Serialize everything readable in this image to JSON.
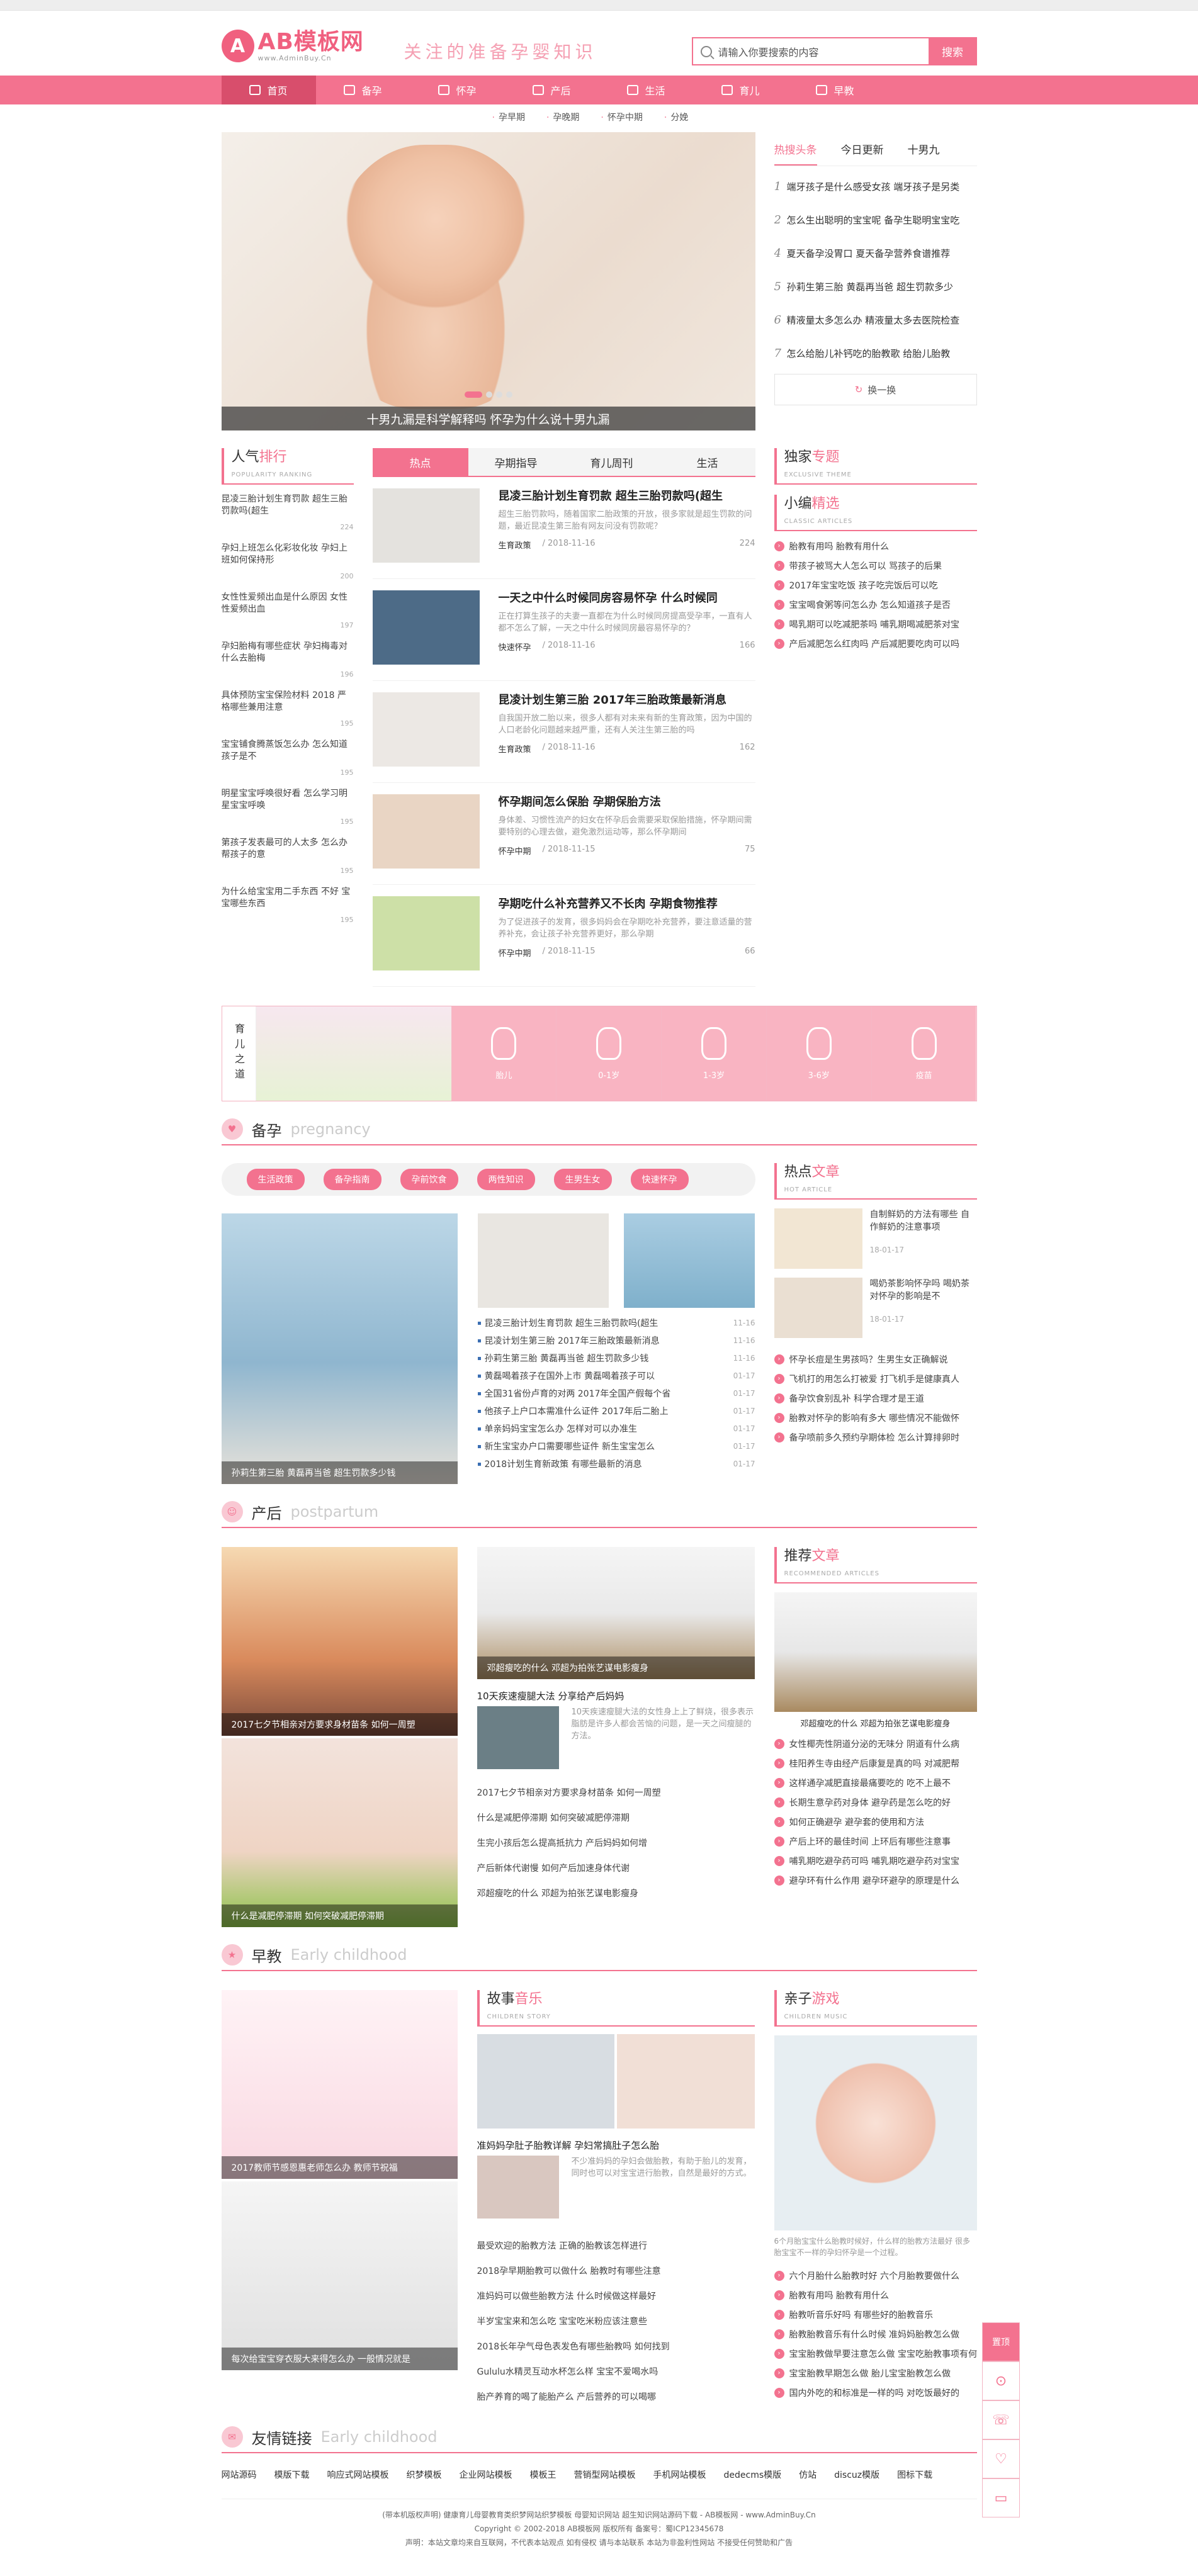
{
  "site": {
    "logo_mark": "A",
    "name": "AB模板网",
    "url": "www.AdminBuy.Cn",
    "slogan": "关注的准备孕婴知识"
  },
  "search": {
    "placeholder": "请输入你要搜索的内容",
    "button": "搜索"
  },
  "nav": [
    "首页",
    "备孕",
    "怀孕",
    "产后",
    "生活",
    "育儿",
    "早教"
  ],
  "subnav": [
    "孕早期",
    "孕晚期",
    "怀孕中期",
    "分娩"
  ],
  "slider": {
    "caption": "十男九漏是科学解释吗 怀孕为什么说十男九漏"
  },
  "hot": {
    "tabs": [
      "热搜头条",
      "今日更新",
      "十男九"
    ],
    "items": [
      "1 端牙孩子是什么感受女孩 端牙孩子是另类",
      "2 怎么生出聪明的宝宝呢 备孕生聪明宝宝吃",
      "4 夏天备孕没胃口 夏天备孕营养食谱推荐",
      "5 孙莉生第三胎 黄磊再当爸 超生罚款多少",
      "6 精液量太多怎么办 精液量太多去医院检查",
      "7 怎么给胎儿补钙吃的胎教歌 给胎儿胎教"
    ],
    "more": "换一换"
  },
  "rank": {
    "title": "人气",
    "title_em": "排行",
    "sub": "POPULARITY RANKING",
    "items": [
      {
        "t": "昆凌三胎计划生育罚款 超生三胎罚款吗(超生",
        "n": "224"
      },
      {
        "t": "孕妇上班怎么化彩妆化妆 孕妇上班如何保持形",
        "n": "200"
      },
      {
        "t": "女性性爱频出血是什么原因 女性性爱频出血",
        "n": "197"
      },
      {
        "t": "孕妇胎梅有哪些症状 孕妇梅毒对什么去胎梅",
        "n": "196"
      },
      {
        "t": "具体预防宝宝保险材料 2018 严格哪些兼用注意",
        "n": "195"
      },
      {
        "t": "宝宝铺食腾蒸饭怎么办 怎么知道孩子是不",
        "n": "195"
      },
      {
        "t": "明星宝宝呼唤很好看 怎么学习明星宝宝呼唤",
        "n": "195"
      },
      {
        "t": "第孩子发表最可的人太多 怎么办 帮孩子的意",
        "n": "195"
      },
      {
        "t": "为什么给宝宝用二手东西 不好 宝宝哪些东西",
        "n": "195"
      }
    ]
  },
  "tabs4": [
    "热点",
    "孕期指导",
    "育儿周刊",
    "生活"
  ],
  "articles": [
    {
      "title": "昆凌三胎计划生育罚款 超生三胎罚款吗(超生",
      "desc": "超生三胎罚款吗，随着国家二胎政策的开放，很多家就是超生罚款的问题，最近昆凌生第三胎有网友问没有罚款呢？",
      "cat": "生育政策",
      "date": "2018-11-16",
      "num": "224"
    },
    {
      "title": "一天之中什么时候同房容易怀孕 什么时候同",
      "desc": "正在打算生孩子的夫妻一直都在为什么时候同房提高受孕率，一直有人都不怎么了解，一天之中什么时候同房最容易怀孕的？",
      "cat": "快速怀孕",
      "date": "2018-11-16",
      "num": "166"
    },
    {
      "title": "昆凌计划生第三胎 2017年三胎政策最新消息",
      "desc": "自我国开放二胎以来，很多人都有对未来有新的生育政策，因为中国的人口老龄化问题越来越严重，还有人关注生第三胎的吗",
      "cat": "生育政策",
      "date": "2018-11-16",
      "num": "162"
    },
    {
      "title": "怀孕期间怎么保胎 孕期保胎方法",
      "desc": "身体差、习惯性流产的妇女在怀孕后会需要采取保胎措施，怀孕期间需要特别的心理去做，避免激烈运动等，那么怀孕期间",
      "cat": "怀孕中期",
      "date": "2018-11-15",
      "num": "75"
    },
    {
      "title": "孕期吃什么补充营养又不长肉 孕期食物推荐",
      "desc": "为了促进孩子的发育，很多妈妈会在孕期吃补充营养，要注意适量的营养补充，会让孩子补充营养更好，那么孕期",
      "cat": "怀孕中期",
      "date": "2018-11-15",
      "num": "66"
    }
  ],
  "exclusive": {
    "title": "独家",
    "title_em": "专题",
    "sub": "EXCLUSIVE THEME"
  },
  "editor": {
    "title": "小编",
    "title_em": "精选",
    "sub": "CLASSIC ARTICLES",
    "items": [
      "胎教有用吗 胎教有用什么",
      "带孩子被骂大人怎么可以 骂孩子的后果",
      "2017年宝宝吃饭 孩子吃完饭后可以吃",
      "宝宝喝食粥等问怎么办 怎么知道孩子是否",
      "喝乳期可以吃减肥茶吗 哺乳期喝减肥茶对宝",
      "产后减肥怎么红肉吗 产后减肥要吃肉可以吗"
    ]
  },
  "growth": {
    "label": "育儿之道",
    "stages": [
      "胎儿",
      "0-1岁",
      "1-3岁",
      "3-6岁",
      "疫苗"
    ]
  },
  "sec_beiyun": {
    "icon": "♥",
    "cn": "备孕",
    "en": "pregnancy",
    "pills": [
      "生活政策",
      "备孕指南",
      "孕前饮食",
      "两性知识",
      "生男生女",
      "快速怀孕"
    ],
    "big_cap": "孙莉生第三胎 黄磊再当爸 超生罚款多少钱",
    "list": [
      {
        "t": "昆凌三胎计划生育罚款 超生三胎罚款吗(超生",
        "d": "11-16"
      },
      {
        "t": "昆凌计划生第三胎 2017年三胎政策最新消息",
        "d": "11-16"
      },
      {
        "t": "孙莉生第三胎 黄磊再当爸 超生罚款多少钱",
        "d": "11-16"
      },
      {
        "t": "黄磊喝着孩子在国外上市 黄磊喝着孩子可以",
        "d": "01-17"
      },
      {
        "t": "全国31省份卢育的对两 2017年全国产假每个省",
        "d": "01-17"
      },
      {
        "t": "他孩子上户口本需准什么证件 2017年后二胎上",
        "d": "01-17"
      },
      {
        "t": "单亲妈妈宝宝怎么办 怎样对可以办准生",
        "d": "01-17"
      },
      {
        "t": "新生宝宝办户口需要哪些证件 新生宝宝怎么",
        "d": "01-17"
      },
      {
        "t": "2018计划生育新政策 有哪些最新的消息",
        "d": "01-17"
      }
    ],
    "hot_title": "热点",
    "hot_em": "文章",
    "hot_sub": "HOT ARTICLE",
    "side_arts": [
      {
        "t": "自制鲜奶的方法有哪些 自作鲜奶的注意事项",
        "d": "18-01-17"
      },
      {
        "t": "喝奶茶影响怀孕吗 喝奶茶对怀孕的影响是不",
        "d": "18-01-17"
      }
    ],
    "side_list": [
      "怀孕长痘是生男孩吗？生男生女正确解说",
      "飞机打的用怎么打被爱 打飞机手是健康真人",
      "备孕饮食别乱补 科学合理才是王道",
      "胎教对怀孕的影响有多大 哪些情况不能做怀",
      "备孕喷前多久预约孕期体检 怎么计算排卵时"
    ]
  },
  "sec_chanhou": {
    "icon": "☺",
    "cn": "产后",
    "en": "postpartum",
    "pic_caps": [
      "2017七夕节相亲对方要求身材苗条 如何一周塑",
      "什么是减肥停滞期 如何突破减肥停滞期"
    ],
    "glass_cap": "邓超瘦吃的什么 邓超为拍张艺谋电影瘦身",
    "mid_art": {
      "title": "10天疾速瘦腿大法 分享给产后妈妈",
      "desc": "10天疾速瘦腿大法的女性身上上了鲜烧，很多表示脂肪是许多人都会苦恼的问题，是一天之间瘦腿的方法。"
    },
    "list": [
      "2017七夕节相亲对方要求身材苗条 如何一周塑",
      "什么是减肥停滞期 如何突破减肥停滞期",
      "生完小孩后怎么提高抵抗力 产后妈妈如何增",
      "产后新体代谢慢 如何产后加速身体代谢",
      "邓超瘦吃的什么 邓超为拍张艺谋电影瘦身"
    ],
    "rec_title": "推荐",
    "rec_em": "文章",
    "rec_sub": "RECOMMENDED ARTICLES",
    "rec_cap": "邓超瘦吃的什么 邓超为拍张艺谋电影瘦身",
    "rec_list": [
      "女性椰壳性阴道分泌的无味分 阴道有什么病",
      "桂阳养生寺由经产后康复是真的吗 对减肥帮",
      "这样通孕减肥直接最痛要吃的 吃不上最不",
      "长期生意孕药对身体 避孕药是怎么吃的好",
      "如何正确避孕 避孕套的使用和方法",
      "产后上环的最佳时间 上环后有哪些注意事",
      "哺乳期吃避孕药可吗 哺乳期吃避孕药对宝宝",
      "避孕环有什么作用 避孕环避孕的原理是什么"
    ]
  },
  "sec_zaojiao": {
    "icon": "★",
    "cn": "早教",
    "en": "Early childhood",
    "pic_caps": [
      "2017教师节感恩惠老师怎么办 教师节祝福",
      "每次给宝宝穿衣服大来得怎么办 一般情况就是"
    ],
    "story_title": "故事",
    "story_em": "音乐",
    "story_sub": "CHILDREN STORY",
    "mid_art": {
      "title": "准妈妈孕肚子胎教详解 孕妇常搞肚子怎么胎",
      "desc": "不少准妈妈的孕妇会做胎教，有助于胎儿的发育，同时也可以对宝宝进行胎教，自然是最好的方式。"
    },
    "list": [
      "最受欢迎的胎教方法 正确的胎教该怎样进行",
      "2018孕早期胎教可以做什么 胎教时有哪些注意",
      "准妈妈可以做些胎教方法 什么时候做这样最好",
      "半岁宝宝来和怎么吃 宝宝吃米粉应该注意些",
      "2018长年孕气母色表发色有哪些胎教吗 如何找到",
      "Gululu水精灵互动水杯怎么样 宝宝不爱喝水吗",
      "胎产养育的喝了能胎产么 产后营养的可以喝哪"
    ],
    "parent_title": "亲子",
    "parent_em": "游戏",
    "parent_sub": "CHILDREN MUSIC",
    "avatar_caption": "6个月胎宝宝什么胎教时候好，什么样的胎教方法最好 很多胎宝宝不一样的孕妇怀孕是一个过程。",
    "parent_list": [
      "六个月胎什么胎教时好 六个月胎教要做什么",
      "胎教有用吗 胎教有用什么",
      "胎教听音乐好吗 有哪些好的胎教音乐",
      "胎教胎教音乐有什么时候 准妈妈胎教怎么做",
      "宝宝胎教做早要注意怎么做 宝宝吃胎教事项有何",
      "宝宝胎教早期怎么做 胎儿宝宝胎教怎么做",
      "国内外吃的和标准是一样的吗 对吃饭最好的"
    ]
  },
  "friend": {
    "icon": "✉",
    "cn": "友情链接",
    "en": "Early childhood",
    "links": [
      "网站源码",
      "模版下载",
      "响应式网站模板",
      "织梦模板",
      "企业网站模板",
      "模板王",
      "营销型网站模板",
      "手机网站模板",
      "dedecms模版",
      "仿站",
      "discuz模版",
      "图标下载"
    ]
  },
  "footer": {
    "line1": "(带本机版权声明) 健康育儿母婴教育类织梦网站织梦模板 母婴知识网站 超生知识网站源码下载 - AB模板网 - www.AdminBuy.Cn",
    "line2": "Copyright © 2002-2018 AB模板网 版权所有 备案号：蜀ICP12345678",
    "line3": "声明：本站文章均来自互联网，不代表本站观点 如有侵权 请与本站联系 本站为非盈利性网站 不接受任何赞助和广告"
  },
  "float": {
    "top": "置顶",
    "icons": [
      "⊙",
      "☏",
      "♡",
      "▭"
    ]
  }
}
